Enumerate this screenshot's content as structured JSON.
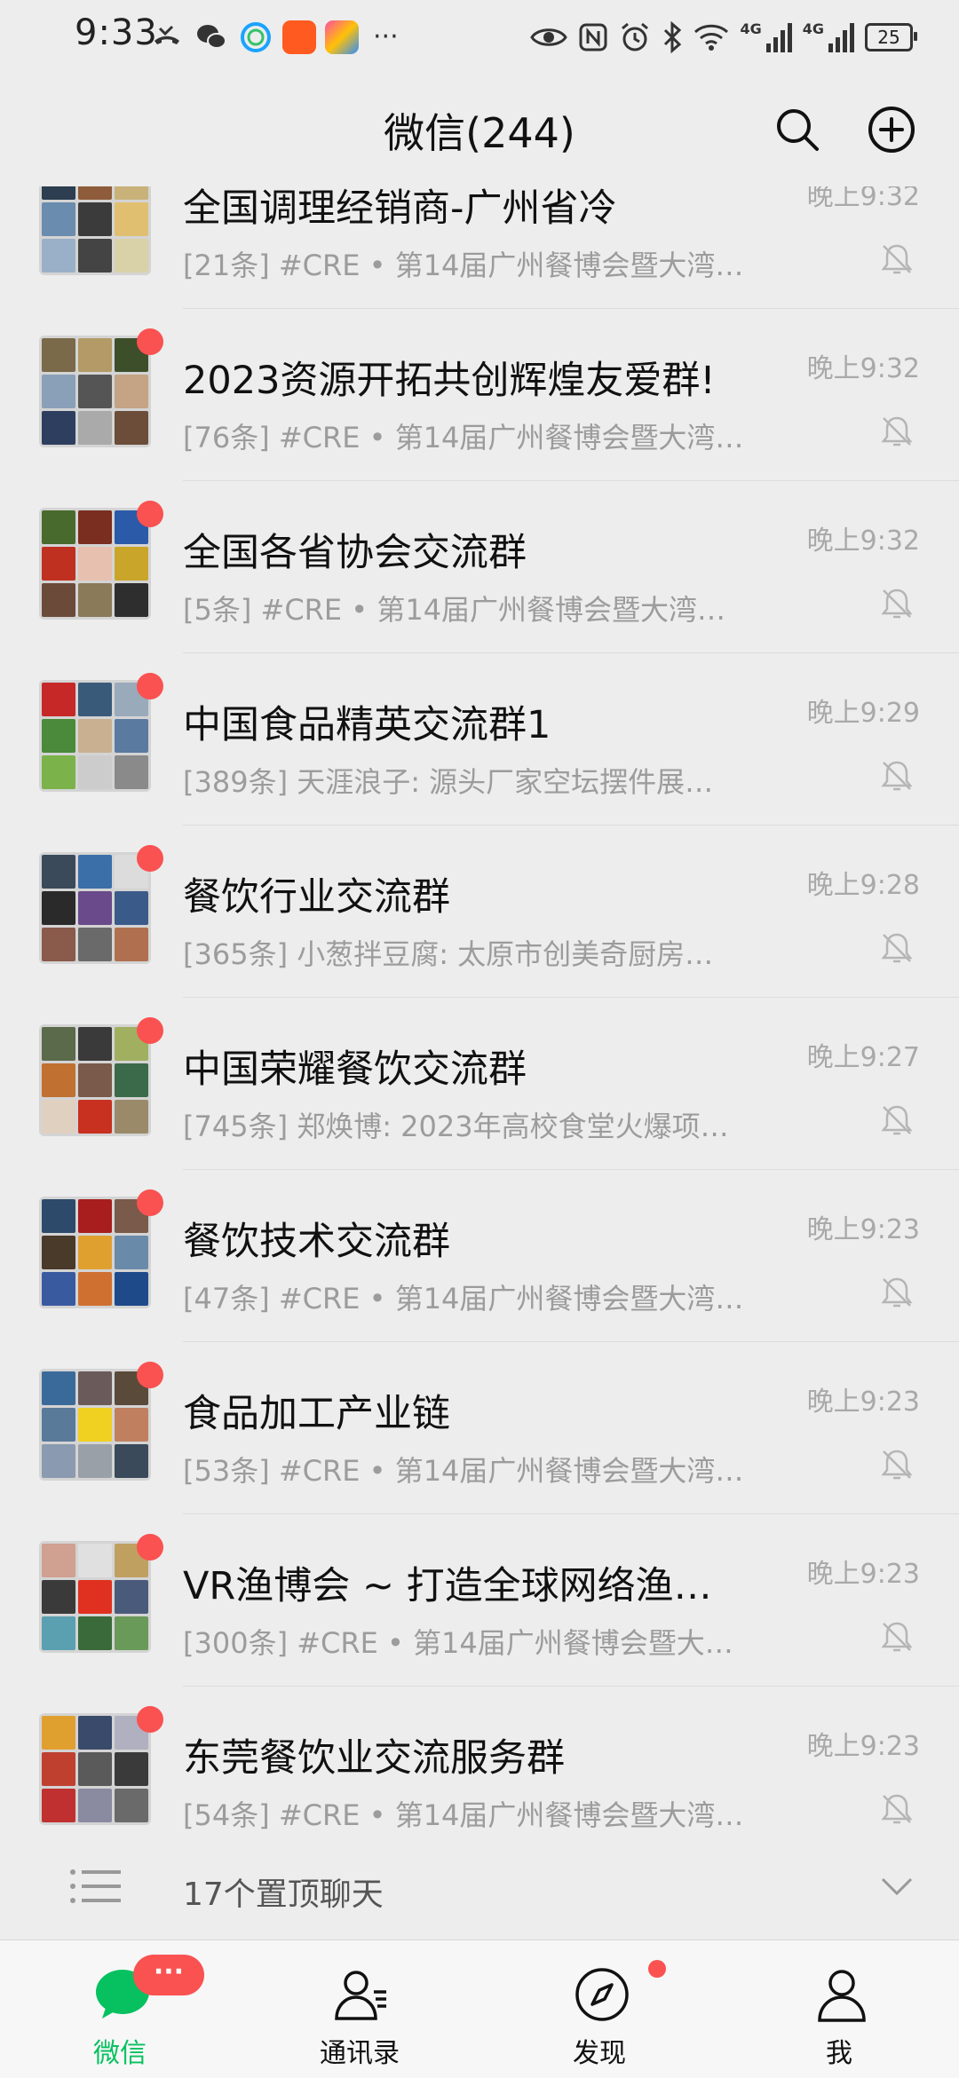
{
  "status_bar": {
    "time": "9:33",
    "signal_1": "4G",
    "signal_2": "4G",
    "battery": "25"
  },
  "header": {
    "title": "微信(244)"
  },
  "chats": [
    {
      "name": "全国调理经销商-广州省冷",
      "preview": "[21条] #CRE • 第14届广州餐博会暨大湾…",
      "time": "晚上9:32",
      "unread_dot": false
    },
    {
      "name": "2023资源开拓共创辉煌友爱群!",
      "preview": "[76条] #CRE • 第14届广州餐博会暨大湾…",
      "time": "晚上9:32",
      "unread_dot": true
    },
    {
      "name": "全国各省协会交流群",
      "preview": "[5条] #CRE • 第14届广州餐博会暨大湾…",
      "time": "晚上9:32",
      "unread_dot": true
    },
    {
      "name": "中国食品精英交流群1",
      "preview": "[389条] 天涯浪子: 源头厂家空坛摆件展…",
      "time": "晚上9:29",
      "unread_dot": true
    },
    {
      "name": "餐饮行业交流群",
      "preview": "[365条] 小葱拌豆腐: 太原市创美奇厨房…",
      "time": "晚上9:28",
      "unread_dot": true
    },
    {
      "name": "中国荣耀餐饮交流群",
      "preview": "[745条] 郑焕博: 2023年高校食堂火爆项…",
      "time": "晚上9:27",
      "unread_dot": true
    },
    {
      "name": "餐饮技术交流群",
      "preview": "[47条] #CRE • 第14届广州餐博会暨大湾…",
      "time": "晚上9:23",
      "unread_dot": true
    },
    {
      "name": "食品加工产业链",
      "preview": "[53条] #CRE • 第14届广州餐博会暨大湾…",
      "time": "晚上9:23",
      "unread_dot": true
    },
    {
      "name": "VR渔博会 ~ 打造全球网络渔…",
      "preview": "[300条] #CRE • 第14届广州餐博会暨大…",
      "time": "晚上9:23",
      "unread_dot": true
    },
    {
      "name": "东莞餐饮业交流服务群",
      "preview": "[54条] #CRE • 第14届广州餐博会暨大湾…",
      "time": "晚上9:23",
      "unread_dot": true
    }
  ],
  "pinned": {
    "label": "17个置顶聊天"
  },
  "tabs": [
    {
      "label": "微信",
      "badge": "···",
      "active": true
    },
    {
      "label": "通讯录"
    },
    {
      "label": "发现",
      "dot": true
    },
    {
      "label": "我"
    }
  ],
  "colors": {
    "accent": "#07c160",
    "badge": "#fa5151",
    "background": "#ededed"
  }
}
